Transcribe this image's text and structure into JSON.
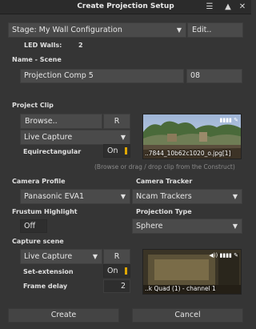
{
  "window": {
    "title": "Create Projection Setup"
  },
  "stage": {
    "value": "Stage: My Wall Configuration",
    "edit_label": "Edit..",
    "led_walls_label": "LED Walls:",
    "led_walls_value": "2"
  },
  "name_scene": {
    "label": "Name - Scene",
    "value": "Projection Comp 5",
    "index": "08"
  },
  "project_clip": {
    "label": "Project Clip",
    "browse_label": "Browse..",
    "r_label": "R",
    "source_value": "Live Capture",
    "equirect_label": "Equirectangular",
    "equirect_value": "On",
    "thumb_caption": "..7844_10b62c1020_o.jpg[1]",
    "hint": "(Browse or drag / drop clip from the Construct)"
  },
  "camera_profile": {
    "label": "Camera Profile",
    "value": "Panasonic EVA1"
  },
  "camera_tracker": {
    "label": "Camera Tracker",
    "value": "Ncam Trackers"
  },
  "frustum": {
    "label": "Frustum Highlight",
    "value": "Off"
  },
  "projection_type": {
    "label": "Projection Type",
    "value": "Sphere"
  },
  "capture_scene": {
    "label": "Capture scene",
    "source_value": "Live Capture",
    "r_label": "R",
    "set_extension_label": "Set-extension",
    "set_extension_value": "On",
    "frame_delay_label": "Frame delay",
    "frame_delay_value": "2",
    "thumb_caption": "..k Quad (1) - channel 1"
  },
  "actions": {
    "create_label": "Create",
    "cancel_label": "Cancel"
  },
  "colors": {
    "accent": "#e0a800",
    "panel": "#353535",
    "field": "#4a4a4a",
    "dark_field": "#2e2e2e"
  }
}
